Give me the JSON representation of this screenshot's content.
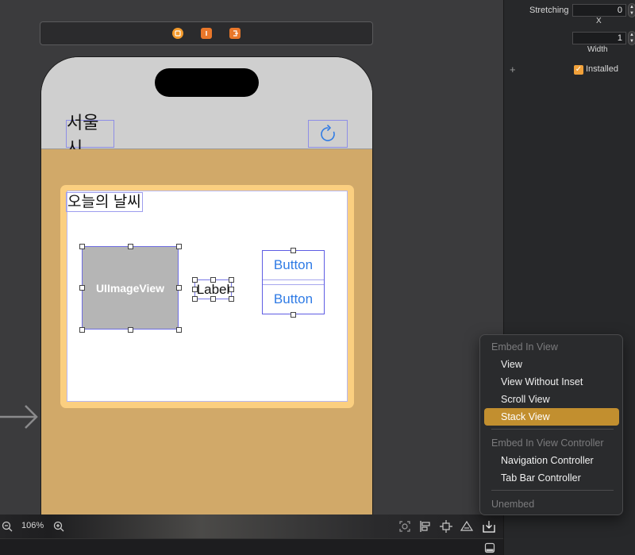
{
  "canvas": {
    "dock_icons": [
      "view-controller-icon",
      "first-responder-icon",
      "exit-icon"
    ],
    "nav": {
      "title": "서울시",
      "refresh_icon": "refresh-icon"
    },
    "card": {
      "title": "오늘의 날씨",
      "image_view_label": "UIImageView",
      "label_text": "Label",
      "stack_buttons": [
        "Button",
        "Button"
      ]
    },
    "entry_arrow_icon": "arrow-right-icon"
  },
  "bottom_bar": {
    "zoom_out_icon": "zoom-out-icon",
    "zoom_level": "106%",
    "zoom_in_icon": "zoom-in-icon",
    "tools": [
      "update-frames-icon",
      "align-icon",
      "add-constraints-icon",
      "resolve-issues-icon",
      "embed-in-icon"
    ],
    "lower_icon": "toggle-panel-icon"
  },
  "inspector": {
    "stretching_label": "Stretching",
    "stretching_x_value": "0",
    "x_label": "X",
    "width_value": "1",
    "width_label": "Width",
    "plus_icon": "plus-icon",
    "installed_label": "Installed",
    "installed_checked": true
  },
  "menu": {
    "header_view": "Embed In View",
    "items_view": [
      "View",
      "View Without Inset",
      "Scroll View",
      "Stack View"
    ],
    "selected": "Stack View",
    "header_controller": "Embed In View Controller",
    "items_controller": [
      "Navigation Controller",
      "Tab Bar Controller"
    ],
    "unembed": "Unembed"
  },
  "colors": {
    "accent": "#c28f2f",
    "content_bg": "#d1a969",
    "card_border": "#fbcf80",
    "button_text": "#2f7be5",
    "checkbox": "#f1a13a"
  }
}
